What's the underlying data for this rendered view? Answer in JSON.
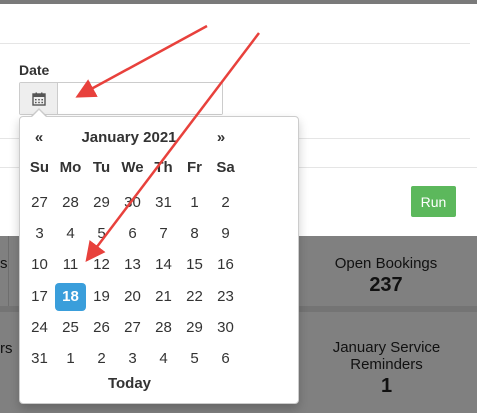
{
  "modal": {
    "date_label": "Date",
    "date_value": "",
    "run_label": "Run"
  },
  "background": {
    "stat_open_label": "Open Bookings",
    "stat_open_value": "237",
    "stat_reminders_label": "January Service Reminders",
    "stat_reminders_value": "1",
    "clip_a": "s",
    "clip_b": "rs"
  },
  "datepicker": {
    "prev": "«",
    "month_year": "January 2021",
    "next": "»",
    "weekdays": [
      "Su",
      "Mo",
      "Tu",
      "We",
      "Th",
      "Fr",
      "Sa"
    ],
    "weeks": [
      [
        "27",
        "28",
        "29",
        "30",
        "31",
        "1",
        "2"
      ],
      [
        "3",
        "4",
        "5",
        "6",
        "7",
        "8",
        "9"
      ],
      [
        "10",
        "11",
        "12",
        "13",
        "14",
        "15",
        "16"
      ],
      [
        "17",
        "18",
        "19",
        "20",
        "21",
        "22",
        "23"
      ],
      [
        "24",
        "25",
        "26",
        "27",
        "28",
        "29",
        "30"
      ],
      [
        "31",
        "1",
        "2",
        "3",
        "4",
        "5",
        "6"
      ]
    ],
    "selected_day": "18",
    "today_label": "Today"
  },
  "colors": {
    "run_button": "#5cb85c",
    "selected_day": "#3a9edb",
    "annotation_arrow": "#e8413c"
  },
  "icons": {
    "calendar": "calendar-icon"
  }
}
